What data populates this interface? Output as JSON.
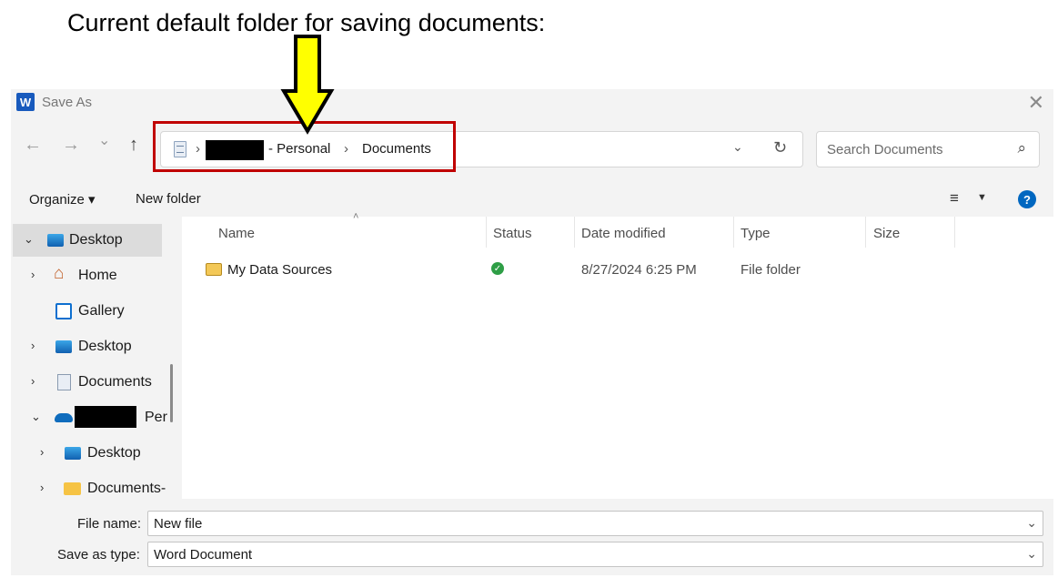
{
  "caption": "Current default folder for saving documents:",
  "window": {
    "app_icon_letter": "W",
    "title": "Save As",
    "close_glyph": "✕"
  },
  "nav": {
    "back_glyph": "←",
    "forward_glyph": "→",
    "recent_glyph": "⌄",
    "up_glyph": "↑"
  },
  "address": {
    "separator": "›",
    "crumbs": [
      "- Personal",
      "Documents"
    ],
    "dropdown_glyph": "⌄",
    "refresh_glyph": "↻"
  },
  "search": {
    "placeholder": "Search Documents",
    "icon_glyph": "⌕"
  },
  "toolbar": {
    "organize_label": "Organize ▾",
    "new_folder_label": "New folder",
    "view_glyph": "≡",
    "view_dropdown_glyph": "▼",
    "help_glyph": "?"
  },
  "sidebar": {
    "items": [
      {
        "label": "Desktop",
        "chevron": "⌄",
        "icon": "desktop-icon"
      },
      {
        "label": "Home",
        "chevron": "›",
        "icon": "home-icon"
      },
      {
        "label": "Gallery",
        "chevron": "",
        "icon": "gallery-icon"
      },
      {
        "label": "Desktop",
        "chevron": "›",
        "icon": "desktop-icon"
      },
      {
        "label": "Documents",
        "chevron": "›",
        "icon": "documents-icon"
      },
      {
        "label": "Per",
        "chevron": "⌄",
        "icon": "onedrive-icon"
      },
      {
        "label": "Desktop",
        "chevron": "›",
        "icon": "desktop-icon"
      },
      {
        "label": "Documents-",
        "chevron": "›",
        "icon": "folder-icon"
      }
    ]
  },
  "files": {
    "columns": [
      "Name",
      "Status",
      "Date modified",
      "Type",
      "Size"
    ],
    "sort_glyph": "˄",
    "rows": [
      {
        "name": "My Data Sources",
        "status": "synced",
        "status_glyph": "✓",
        "date": "8/27/2024 6:25 PM",
        "type": "File folder",
        "size": ""
      }
    ]
  },
  "form": {
    "file_name_label": "File name:",
    "file_name_value": "New file",
    "save_type_label": "Save as type:",
    "save_type_value": "Word Document",
    "dropdown_glyph": "⌄"
  },
  "colors": {
    "highlight_border": "#c00000",
    "arrow_fill": "#ffff00",
    "accent": "#0067c0"
  }
}
